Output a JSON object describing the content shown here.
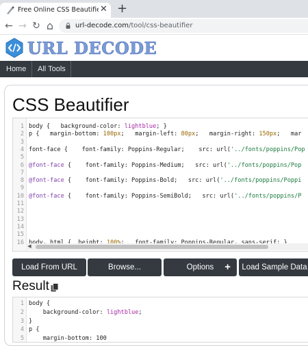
{
  "browser": {
    "tab_title": "Free Online CSS Beautifier / Formatter",
    "tab_close": "✕",
    "new_tab": "+",
    "back": "←",
    "forward": "→",
    "reload": "↻",
    "home": "⌂",
    "url_host": "url-decode.com",
    "url_path": "/tool/css-beautifier"
  },
  "site": {
    "logo_text": "URL DECODE",
    "logo_icon": "code-bracket-icon",
    "nav": [
      "Home",
      "All Tools"
    ]
  },
  "main": {
    "title": "CSS Beautifier",
    "input_lines": [
      {
        "n": "1",
        "parts": [
          [
            "t",
            "body {   background-color: "
          ],
          [
            "v",
            "lightblue"
          ],
          [
            "t",
            "; }"
          ]
        ]
      },
      {
        "n": "2",
        "parts": [
          [
            "t",
            "p {   margin-bottom: "
          ],
          [
            "n",
            "100px"
          ],
          [
            "t",
            ";   margin-left: "
          ],
          [
            "n",
            "80px"
          ],
          [
            "t",
            ";   margin-right: "
          ],
          [
            "n",
            "150px"
          ],
          [
            "t",
            ";   mar"
          ]
        ]
      },
      {
        "n": "3",
        "parts": []
      },
      {
        "n": "4",
        "parts": [
          [
            "t",
            "font-face {    font-family: Poppins-Regular;    src: url("
          ],
          [
            "s",
            "'../fonts/poppins/Pop"
          ]
        ]
      },
      {
        "n": "5",
        "parts": []
      },
      {
        "n": "6",
        "parts": [
          [
            "a",
            "@font-face"
          ],
          [
            "t",
            " {    font-family: Poppins-Medium;   src: url("
          ],
          [
            "s",
            "'../fonts/poppins/Pop"
          ]
        ]
      },
      {
        "n": "7",
        "parts": []
      },
      {
        "n": "8",
        "parts": [
          [
            "a",
            "@font-face"
          ],
          [
            "t",
            " {    font-family: Poppins-Bold;   src: url("
          ],
          [
            "s",
            "'../fonts/poppins/Poppi"
          ]
        ]
      },
      {
        "n": "9",
        "parts": []
      },
      {
        "n": "10",
        "parts": [
          [
            "a",
            "@font-face"
          ],
          [
            "t",
            " {    font-family: Poppins-SemiBold;   src: url("
          ],
          [
            "s",
            "'../fonts/poppins/P"
          ]
        ]
      },
      {
        "n": "11",
        "parts": []
      },
      {
        "n": "12",
        "parts": []
      },
      {
        "n": "13",
        "parts": []
      },
      {
        "n": "14",
        "parts": []
      },
      {
        "n": "15",
        "parts": []
      },
      {
        "n": "16",
        "parts": [
          [
            "t",
            "body, html {  height: "
          ],
          [
            "n",
            "100%"
          ],
          [
            "t",
            ";   font-family: Poppins-Regular, sans-serif; }"
          ]
        ]
      }
    ],
    "buttons": {
      "load_url": "Load From URL",
      "browse": "Browse...",
      "options": "Options",
      "options_icon": "+",
      "load_sample": "Load Sample Data"
    },
    "result_title": "Result",
    "result_lines": [
      {
        "n": "1",
        "parts": [
          [
            "t",
            "body {"
          ]
        ]
      },
      {
        "n": "2",
        "parts": [
          [
            "t",
            "    background-color: "
          ],
          [
            "v",
            "lightblue"
          ],
          [
            "t",
            ";"
          ]
        ]
      },
      {
        "n": "3",
        "parts": [
          [
            "t",
            "}"
          ]
        ]
      },
      {
        "n": "4",
        "parts": [
          [
            "t",
            "p {"
          ]
        ]
      },
      {
        "n": "5",
        "parts": [
          [
            "t",
            "    margin-bottom: 100"
          ]
        ]
      }
    ]
  },
  "colors": {
    "nav_bg": "#343a40",
    "logo_blue": "#7a9bd6",
    "at_rule": "#7d3fa8",
    "value": "#a626a4",
    "string": "#1a7a3c"
  }
}
